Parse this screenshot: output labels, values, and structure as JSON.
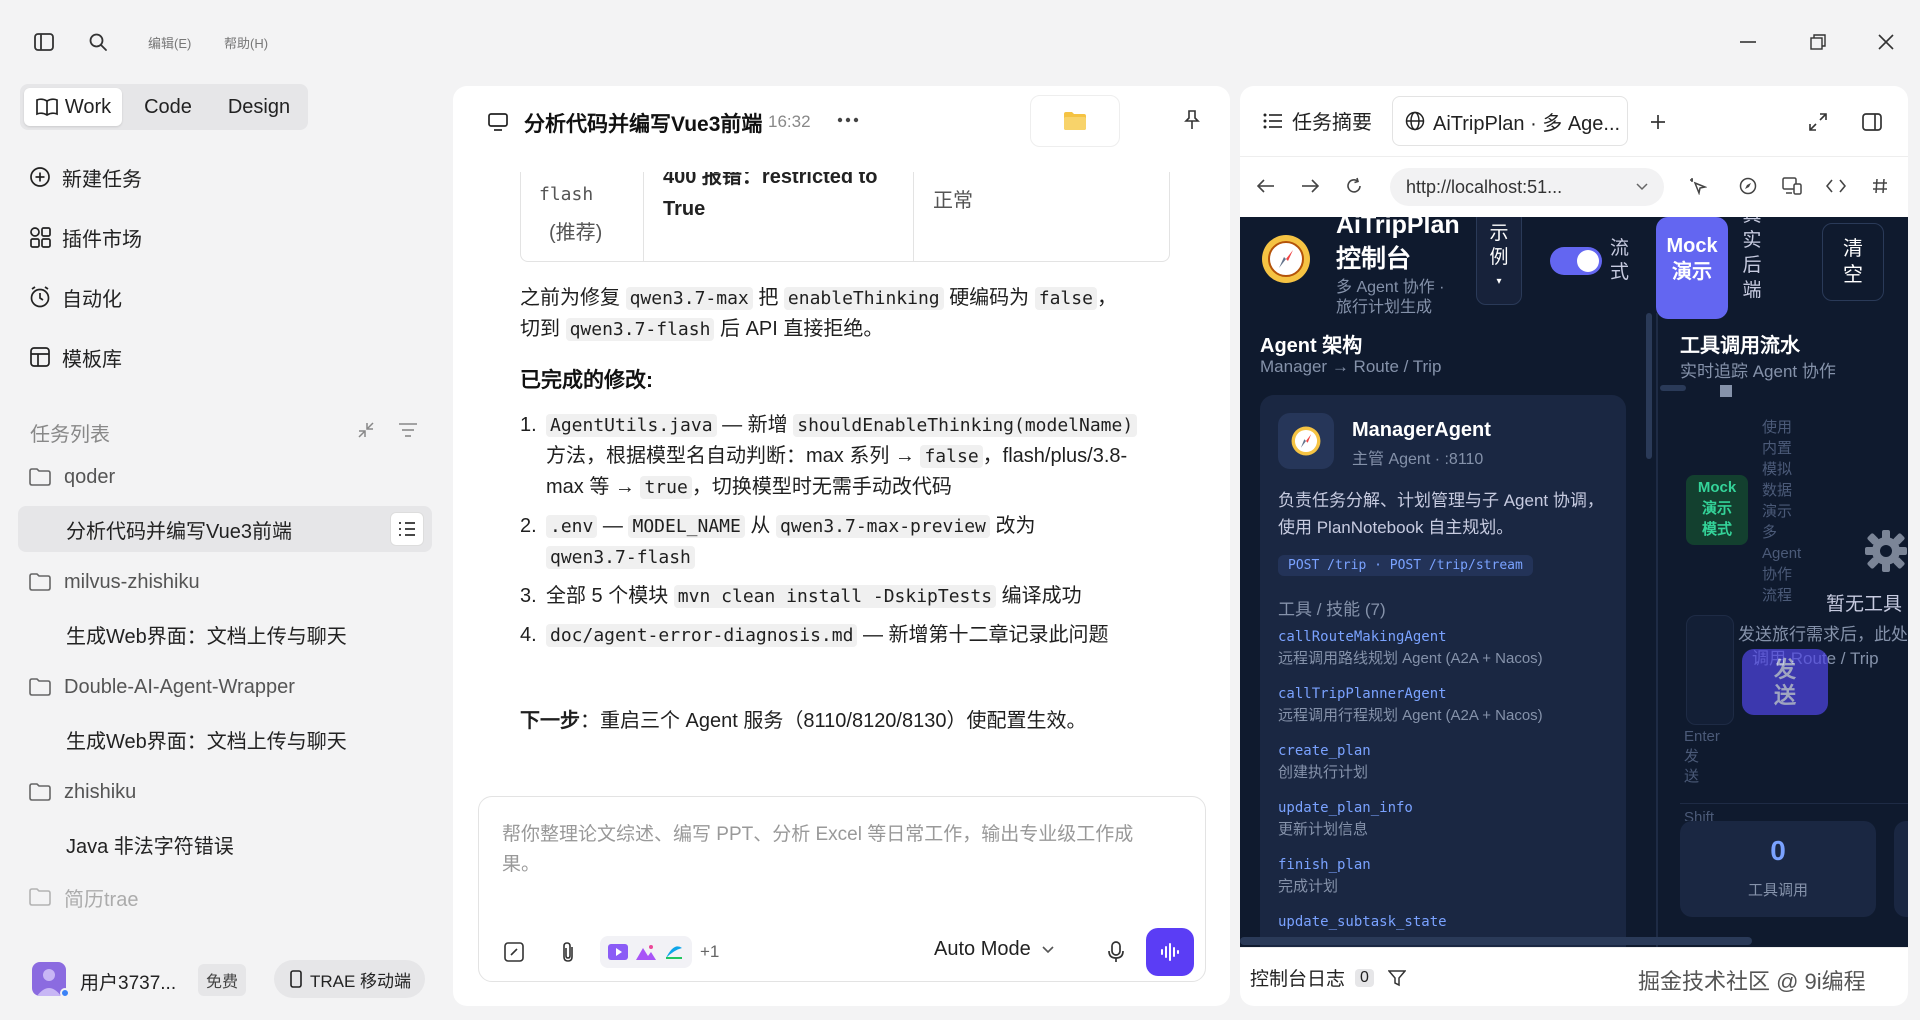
{
  "titlebar": {
    "menu_edit": "编辑(E)",
    "menu_help": "帮助(H)"
  },
  "sidebar": {
    "modes": [
      "Work",
      "Code",
      "Design"
    ],
    "nav": [
      {
        "label": "新建任务",
        "icon": "plus-circle-icon"
      },
      {
        "label": "插件市场",
        "icon": "plugin-icon"
      },
      {
        "label": "自动化",
        "icon": "clock-icon"
      },
      {
        "label": "模板库",
        "icon": "template-icon"
      }
    ],
    "task_list_title": "任务列表",
    "tree": [
      {
        "type": "folder",
        "label": "qoder"
      },
      {
        "type": "task",
        "label": "分析代码并编写Vue3前端",
        "active": true
      },
      {
        "type": "folder",
        "label": "milvus-zhishiku"
      },
      {
        "type": "task",
        "label": "生成Web界面：文档上传与聊天"
      },
      {
        "type": "folder",
        "label": "Double-AI-Agent-Wrapper"
      },
      {
        "type": "task",
        "label": "生成Web界面：文档上传与聊天"
      },
      {
        "type": "folder",
        "label": "zhishiku"
      },
      {
        "type": "task",
        "label": "Java 非法字符错误"
      },
      {
        "type": "folder",
        "label": "简历trae"
      }
    ],
    "user_name": "用户3737...",
    "plan_badge": "免费",
    "mobile_button": "TRAE 移动端"
  },
  "chat": {
    "title": "分析代码并编写Vue3前端",
    "time": "16:32",
    "table_row": {
      "col1_line1": "flash",
      "col1_line2": "(推荐)",
      "col2_line1": "400 报错：restricted to",
      "col2_line2": "True",
      "col3": "正常"
    },
    "para1_a": "之前为修复",
    "para1_code1": "qwen3.7-max",
    "para1_b": "把",
    "para1_code2": "enableThinking",
    "para1_c": "硬编码为",
    "para1_code3": "false",
    "para1_d": "，",
    "para1_e": "切到",
    "para1_code4": "qwen3.7-flash",
    "para1_f": "后 API 直接拒绝。",
    "section_title": "已完成的修改:",
    "steps": [
      {
        "num": "1.",
        "code1": "AgentUtils.java",
        "text1": " — 新增",
        "code2": "shouldEnableThinking(modelName)",
        "text2": " 方法，根据模型名自动判断：max 系列 →",
        "code3": "false",
        "text3": "，flash/plus/3.8-max 等 →",
        "code4": "true",
        "text4": "，切换模型时无需手动改代码"
      },
      {
        "num": "2.",
        "code1": ".env",
        "text1": " — ",
        "code2": "MODEL_NAME",
        "text2": " 从 ",
        "code3": "qwen3.7-max-preview",
        "text3": " 改为",
        "code4": "qwen3.7-flash"
      },
      {
        "num": "3.",
        "text1": "全部 5 个模块 ",
        "code1": "mvn clean install -DskipTests",
        "text2": " 编译成功"
      },
      {
        "num": "4.",
        "code1": "doc/agent-error-diagnosis.md",
        "text1": " — 新增第十二章记录此问题"
      }
    ],
    "next_label": "下一步",
    "next_text": "：重启三个 Agent 服务（8110/8120/8130）使配置生效。",
    "input_placeholder": "帮你整理论文综述、编写 PPT、分析 Excel 等日常工作，输出专业级工作成果。",
    "plus_count": "+1",
    "mode_select": "Auto Mode"
  },
  "browser": {
    "tab_summary": "任务摘要",
    "tab_page": "AiTripPlan · 多 Age...",
    "url": "http://localhost:51...",
    "console_label": "控制台日志",
    "console_count": "0"
  },
  "app": {
    "title_line1": "AiTripPlan",
    "title_line2": "控制台",
    "subtitle_line1": "多 Agent 协作 ·",
    "subtitle_line2": "旅行计划生成",
    "example_chars": [
      "示",
      "例"
    ],
    "stream_chars": [
      "流",
      "式"
    ],
    "mock_line1": "Mock",
    "mock_line2": "演示",
    "real_chars": [
      "真",
      "实",
      "后",
      "端"
    ],
    "clear_chars": [
      "清",
      "空"
    ],
    "arch_title": "Agent 架构",
    "arch_sub": "Manager → Route / Trip",
    "tool_title": "工具调用流水",
    "tool_sub": "实时追踪 Agent 协作",
    "agent_name": "ManagerAgent",
    "agent_meta": "主管 Agent · :8110",
    "agent_desc": "负责任务分解、计划管理与子 Agent 协调，使用 PlanNotebook 自主规划。",
    "endpoints": "POST /trip · POST /trip/stream",
    "skills_title": "工具 / 技能 (7)",
    "skills": [
      {
        "name": "callRouteMakingAgent",
        "desc": "远程调用路线规划 Agent (A2A + Nacos)"
      },
      {
        "name": "callTripPlannerAgent",
        "desc": "远程调用行程规划 Agent (A2A + Nacos)"
      },
      {
        "name": "create_plan",
        "desc": "创建执行计划"
      },
      {
        "name": "update_plan_info",
        "desc": "更新计划信息"
      },
      {
        "name": "finish_plan",
        "desc": "完成计划"
      },
      {
        "name": "update_subtask_state",
        "desc": ""
      }
    ],
    "mock_mode_chars": [
      "Mock",
      "演示",
      "模式"
    ],
    "mock_note_chars": [
      "使用",
      "内置",
      "模拟",
      "数据",
      "演示",
      "多",
      "Agent",
      "协作",
      "流程"
    ],
    "no_tools": "暂无工具",
    "hint_line1": "发送旅行需求后，此处",
    "hint_line2": "调用 Route / Trip",
    "send_chars": [
      "发",
      "送"
    ],
    "enter_chars": [
      "Enter",
      "发",
      "送"
    ],
    "shift": "Shift",
    "stat_value": "0",
    "stat_label": "工具调用"
  },
  "watermark": "掘金技术社区 @ 9i编程"
}
